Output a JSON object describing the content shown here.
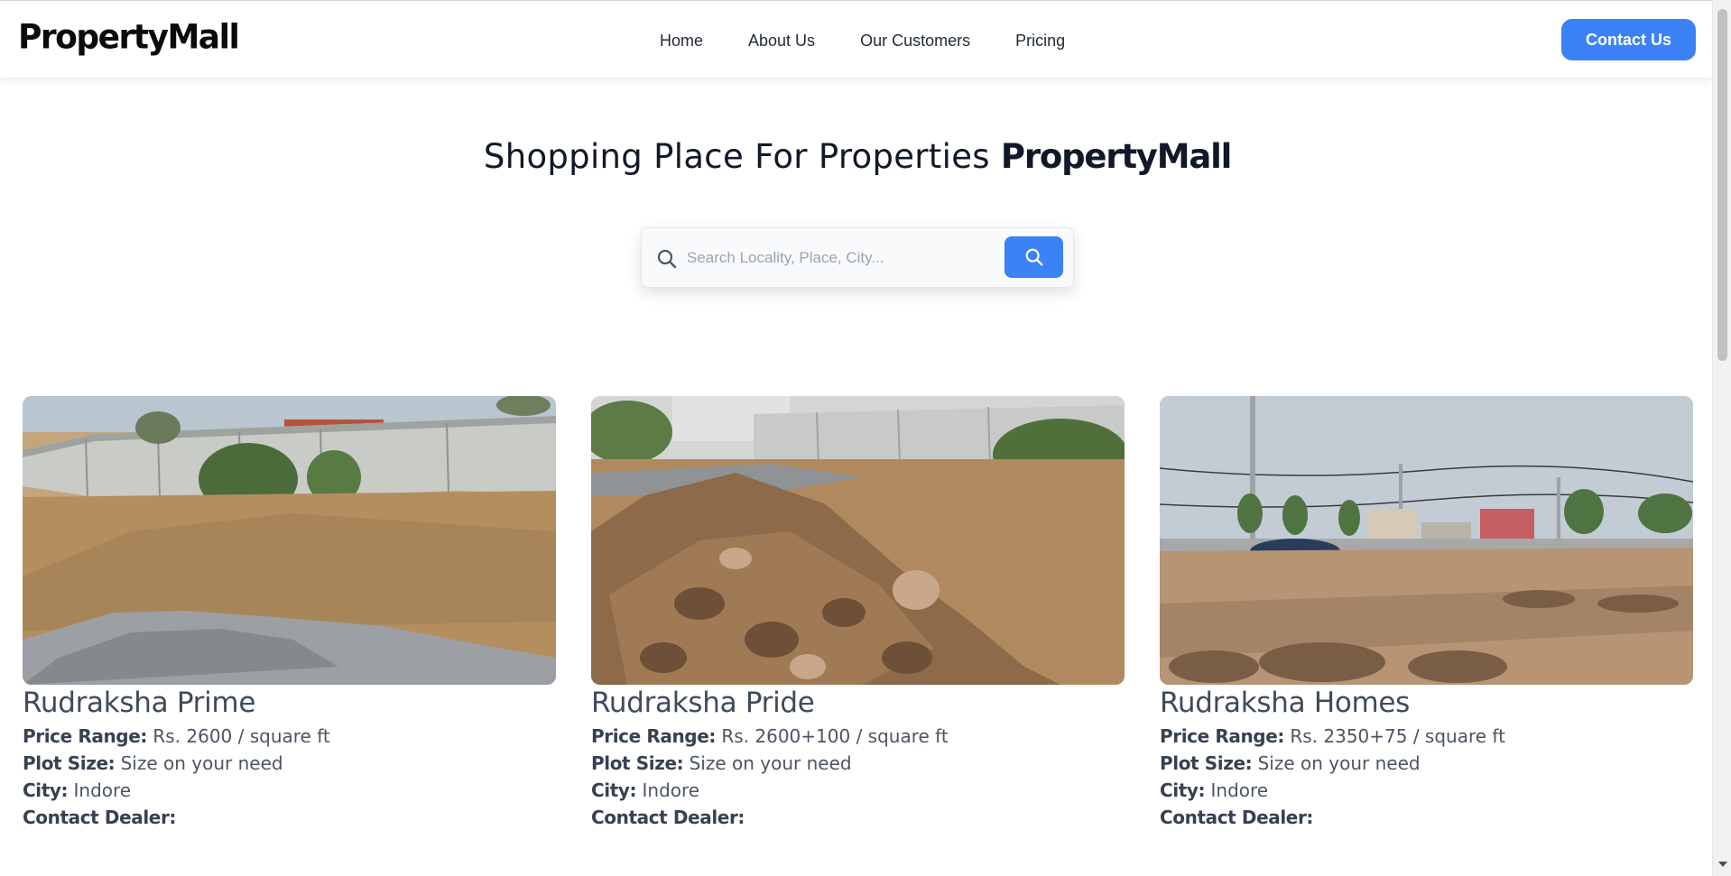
{
  "header": {
    "logo": "PropertyMall",
    "nav": [
      {
        "label": "Home"
      },
      {
        "label": "About Us"
      },
      {
        "label": "Our Customers"
      },
      {
        "label": "Pricing"
      }
    ],
    "contact_button": "Contact Us"
  },
  "hero": {
    "title_plain": "Shopping Place For Properties ",
    "title_brand": "PropertyMall"
  },
  "search": {
    "placeholder": "Search Locality, Place, City...",
    "value": ""
  },
  "listings": [
    {
      "name": "Rudraksha Prime",
      "price_label": "Price Range:",
      "price": "Rs. 2600 / square ft",
      "plot_label": "Plot Size:",
      "plot": "Size on your need",
      "city_label": "City:",
      "city": "Indore",
      "dealer_label": "Contact Dealer:"
    },
    {
      "name": "Rudraksha Pride",
      "price_label": "Price Range:",
      "price": "Rs. 2600+100 / square ft",
      "plot_label": "Plot Size:",
      "plot": "Size on your need",
      "city_label": "City:",
      "city": "Indore",
      "dealer_label": "Contact Dealer:"
    },
    {
      "name": "Rudraksha Homes",
      "price_label": "Price Range:",
      "price": "Rs. 2350+75 / square ft",
      "plot_label": "Plot Size:",
      "plot": "Size on your need",
      "city_label": "City:",
      "city": "Indore",
      "dealer_label": "Contact Dealer:"
    }
  ],
  "colors": {
    "accent": "#3b82f6",
    "heading": "#111827",
    "card_title": "#3f4b5a"
  },
  "icons": {
    "search": "search-icon",
    "search_button": "search-icon"
  }
}
